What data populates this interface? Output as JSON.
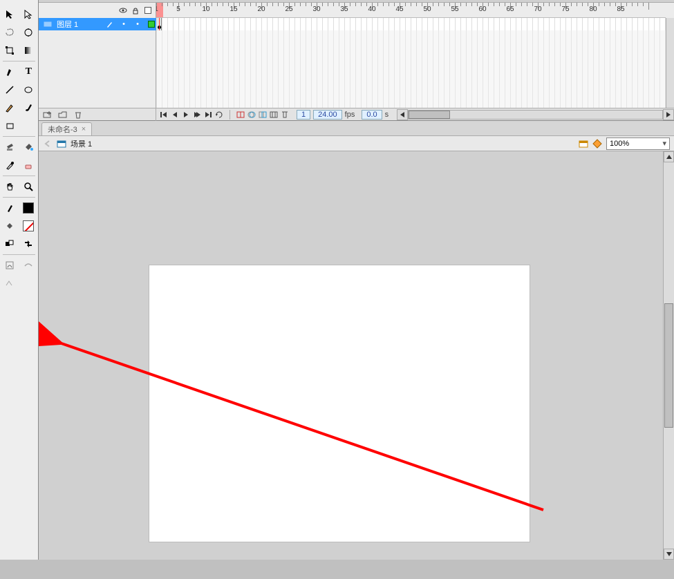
{
  "toolbox": {
    "tools": [
      [
        "selection",
        "subselection"
      ],
      [
        "lasso",
        "magic-wand"
      ],
      [
        "free-transform",
        "gradient-transform"
      ],
      [
        "pen",
        "text"
      ],
      [
        "line",
        "oval"
      ],
      [
        "pencil",
        "brush"
      ],
      [
        "rectangle",
        ""
      ],
      [
        "ink-bottle",
        "paint-bucket"
      ],
      [
        "eyedropper",
        "eraser"
      ],
      [
        "hand",
        "zoom"
      ]
    ],
    "strokeSwatch": "#000000",
    "fillSwatch": "none",
    "snapLabel": "",
    "optionIcons": [
      "swap-colors",
      "default-colors"
    ],
    "bottomIcons": [
      "deco",
      "smooth"
    ]
  },
  "timeline": {
    "headerIcons": [
      "visibility",
      "lock",
      "outline"
    ],
    "rulerMajor": [
      1,
      5,
      10,
      15,
      20,
      25,
      30,
      35,
      40,
      45,
      50,
      55,
      60,
      65,
      70,
      75,
      80,
      85
    ],
    "playhead": 1,
    "layers": [
      {
        "name": "图层 1",
        "color": "#33cc33",
        "pencil": true,
        "dots": [
          true,
          true
        ],
        "keyframeAt": 1
      }
    ],
    "layerButtons": [
      "new-layer",
      "new-folder",
      "delete-layer"
    ],
    "playbackIcons": [
      "goto-first",
      "prev-frame",
      "play",
      "next-frame",
      "goto-last",
      "loop"
    ],
    "actionIcons": [
      "center-frame",
      "onion-skin",
      "onion-outlines",
      "edit-multiple",
      "marker"
    ],
    "status": {
      "frame": "1",
      "fps": "24.00",
      "fpsLabel": "fps",
      "time": "0.0",
      "timeLabel": "s"
    }
  },
  "document": {
    "tabName": "未命名-3",
    "sceneBackLabel": "",
    "sceneLabel": "场景 1",
    "editSceneTip": "",
    "editSymbolTip": "",
    "zoomValue": "100%"
  },
  "annotation": {
    "note": "red-arrow-pointing-to-toolbox"
  }
}
